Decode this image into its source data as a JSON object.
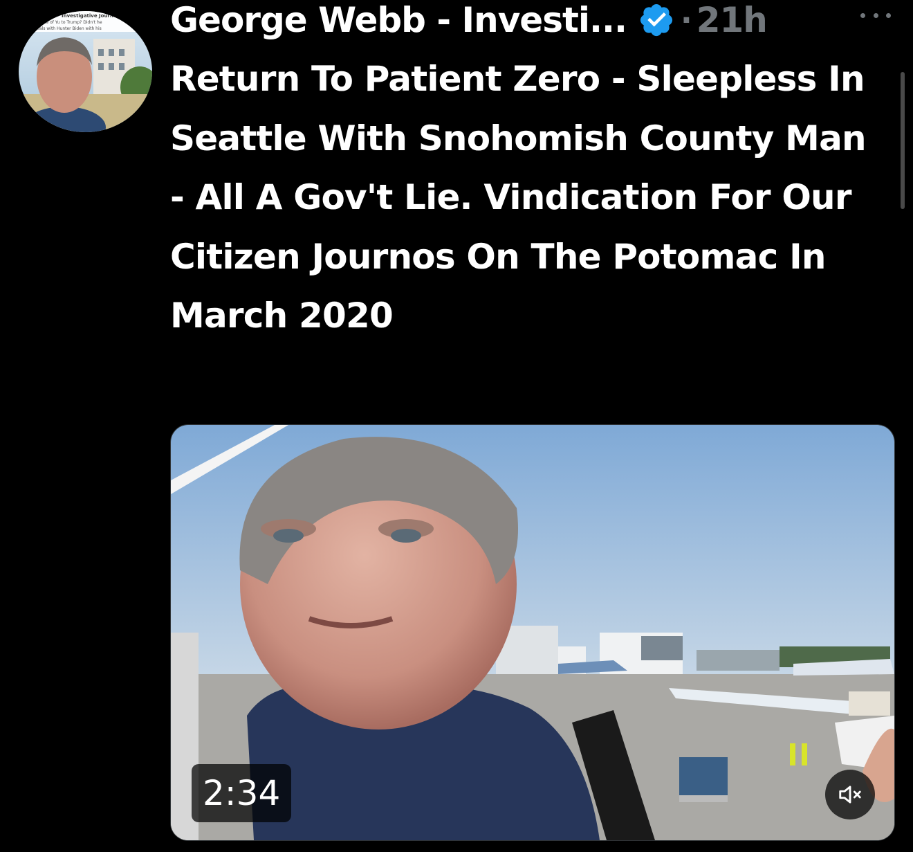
{
  "tweet": {
    "author_name": "George Webb - Investi...",
    "timestamp": "21h",
    "separator": "·",
    "text": "Return To Patient Zero - Sleepless In Seattle With Snohomish County Man - All A Gov't Lie. Vindication For Our Citizen Journos On The Potomac In March 2020"
  },
  "avatar": {
    "caption_line1": "Investigative Journalist",
    "caption_line2": "ame of Yu to Trump? Didn't he",
    "caption_line3": "ons deals with Hunter Biden with his"
  },
  "media": {
    "duration": "2:34"
  },
  "icons": {
    "verified": "verified-badge-icon",
    "more": "more-options-icon",
    "mute": "speaker-muted-icon"
  },
  "colors": {
    "background": "#000000",
    "text": "#ffffff",
    "secondary_text": "#71767b",
    "verified": "#1d9bf0"
  }
}
